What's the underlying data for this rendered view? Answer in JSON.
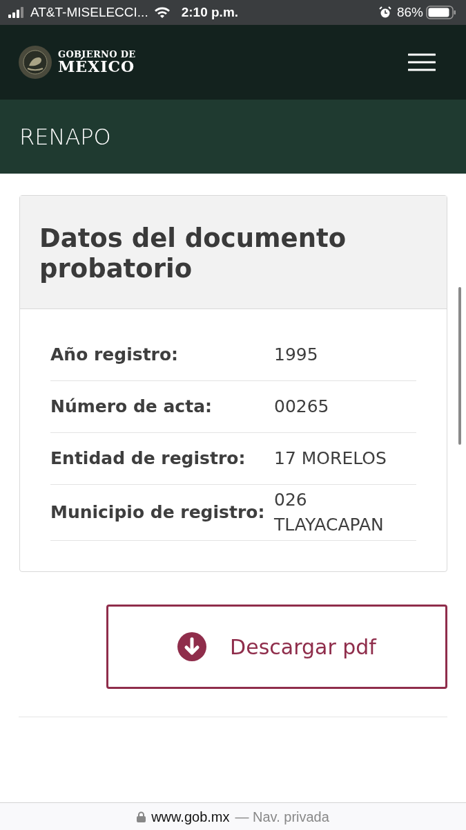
{
  "status_bar": {
    "carrier": "AT&T-MISELECCI...",
    "time": "2:10 p.m.",
    "battery": "86%"
  },
  "header": {
    "logo_line_1": "GOBIERNO DE",
    "logo_line_2": "MÉXICO"
  },
  "banner": {
    "title": "RENAPO"
  },
  "card": {
    "title": "Datos del documento probatorio",
    "rows": [
      {
        "label": "Año registro:",
        "value": "1995"
      },
      {
        "label": "Número de acta:",
        "value": "00265"
      },
      {
        "label": "Entidad de registro:",
        "value": "17 MORELOS"
      },
      {
        "label": "Municipio de registro:",
        "value": "026 TLAYACAPAN"
      }
    ]
  },
  "download_button": {
    "label": "Descargar pdf"
  },
  "browser_bar": {
    "domain": "www.gob.mx",
    "mode": "— Nav. privada"
  }
}
